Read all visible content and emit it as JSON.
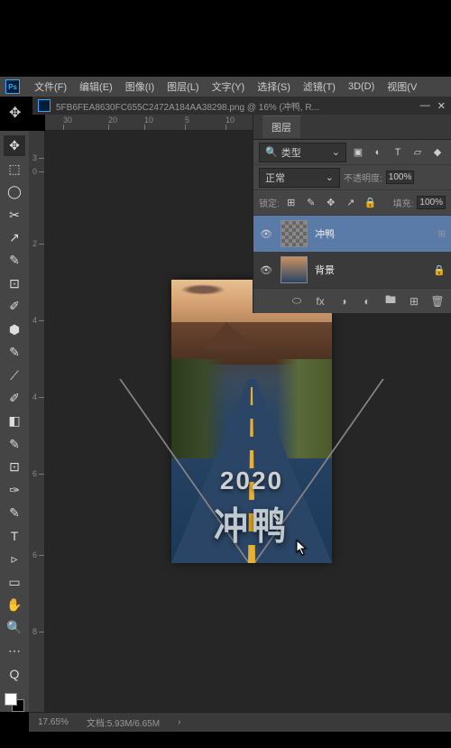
{
  "menu": {
    "file": "文件(F)",
    "edit": "编辑(E)",
    "image": "图像(I)",
    "layer": "图层(L)",
    "text": "文字(Y)",
    "select": "选择(S)",
    "filter": "滤镜(T)",
    "view3d": "3D(D)",
    "view": "视图(V"
  },
  "doc": {
    "title": "5FB6FEA8630FC655C2472A184AA38298.png @ 16% (冲鸭, R...",
    "min": "—",
    "close": "✕"
  },
  "ruler_h": [
    {
      "p": 20,
      "v": "30"
    },
    {
      "p": 70,
      "v": "20"
    },
    {
      "p": 110,
      "v": "10"
    },
    {
      "p": 155,
      "v": "5"
    },
    {
      "p": 200,
      "v": "10"
    }
  ],
  "ruler_v": [
    {
      "p": 30,
      "v": "3"
    },
    {
      "p": 45,
      "v": "0"
    },
    {
      "p": 125,
      "v": "2"
    },
    {
      "p": 210,
      "v": "4"
    },
    {
      "p": 295,
      "v": "4"
    },
    {
      "p": 380,
      "v": "6"
    },
    {
      "p": 470,
      "v": "6"
    },
    {
      "p": 555,
      "v": "8"
    }
  ],
  "layers_panel": {
    "tab": "图层",
    "kind_label": "类型",
    "blend": "正常",
    "opacity_label": "不透明度:",
    "opacity_value": "100%",
    "lock_label": "锁定:",
    "fill_label": "填充:",
    "fill_value": "100%",
    "layers": [
      {
        "name": "冲鸭",
        "visible": true,
        "selected": true,
        "thumb": "checker",
        "link": "⊞"
      },
      {
        "name": "背景",
        "visible": true,
        "selected": false,
        "thumb": "img",
        "lock": "🔒"
      }
    ]
  },
  "artwork": {
    "year": "2020",
    "cn": "冲鸭"
  },
  "status": {
    "zoom": "17.65%",
    "doc": "文档:5.93M/6.65M",
    "arrow": "›"
  },
  "icons": {
    "search": "🔍",
    "chevron": "⌄",
    "img": "▣",
    "circle": "◐",
    "text": "T",
    "shape": "▱",
    "fx": "◆",
    "lock_pos": "⊞",
    "brush": "✎",
    "move": "✥",
    "arrow": "↗",
    "lock": "🔒",
    "link": "⬭",
    "fx2": "fx",
    "mask": "◑",
    "adj": "◐",
    "group": "🖿",
    "new": "⊞",
    "trash": "🗑"
  },
  "tools": [
    "✥",
    "⬚",
    "◯",
    "✂",
    "↗",
    "✎",
    "⊡",
    "✐",
    "⬢",
    "✎",
    "⟋",
    "✐",
    "◧",
    "✎",
    "⊡",
    "✑",
    "✎",
    "T",
    "▹",
    "▭",
    "✋",
    "🔍",
    "⋯",
    "Q"
  ]
}
